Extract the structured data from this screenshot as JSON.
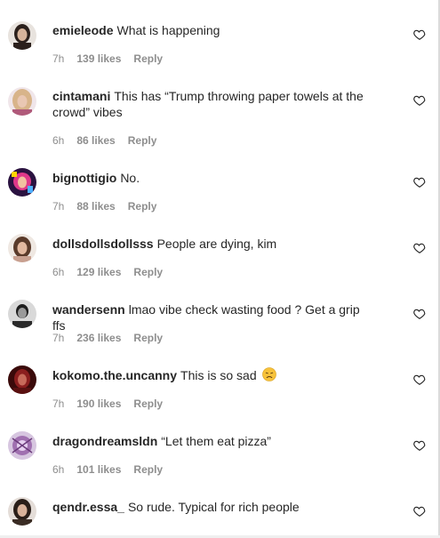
{
  "comments": [
    {
      "username": "emieleode",
      "text": "What is happening",
      "time": "7h",
      "likes": "139 likes",
      "reply": "Reply",
      "avatar": "avatar-dark-hair",
      "avatar_color": "#3a2e2a"
    },
    {
      "username": "cintamani",
      "text": "This has “Trump throwing paper towels at the crowd” vibes",
      "time": "6h",
      "likes": "86 likes",
      "reply": "Reply",
      "avatar": "avatar-blonde",
      "avatar_color": "#c9a6b8"
    },
    {
      "username": "bignottigio",
      "text": "No.",
      "time": "7h",
      "likes": "88 likes",
      "reply": "Reply",
      "avatar": "avatar-colorful",
      "avatar_color": "#8a2be2"
    },
    {
      "username": "dollsdollsdollsss",
      "text": "People are dying, kim",
      "time": "6h",
      "likes": "129 likes",
      "reply": "Reply",
      "avatar": "avatar-woman",
      "avatar_color": "#b08870"
    },
    {
      "username": "wandersenn",
      "text": "lmao vibe check wasting food ? Get a grip ffs",
      "time": "7h",
      "likes": "236 likes",
      "reply": "Reply",
      "avatar": "avatar-bw",
      "avatar_color": "#555555"
    },
    {
      "username": "kokomo.the.uncanny",
      "text": "This is so sad",
      "emoji": "disappointed-face-emoji",
      "time": "7h",
      "likes": "190 likes",
      "reply": "Reply",
      "avatar": "avatar-red",
      "avatar_color": "#7a1a1a"
    },
    {
      "username": "dragondreamsldn",
      "text": "“Let them eat pizza”",
      "time": "6h",
      "likes": "101 likes",
      "reply": "Reply",
      "avatar": "avatar-purple",
      "avatar_color": "#a070b0"
    },
    {
      "username": "qendr.essa_",
      "text": "So rude. Typical for rich people",
      "time": "",
      "likes": "",
      "reply": "",
      "avatar": "avatar-woman-dark",
      "avatar_color": "#4a3a30"
    }
  ],
  "icons": {
    "like": "heart-outline-icon"
  }
}
